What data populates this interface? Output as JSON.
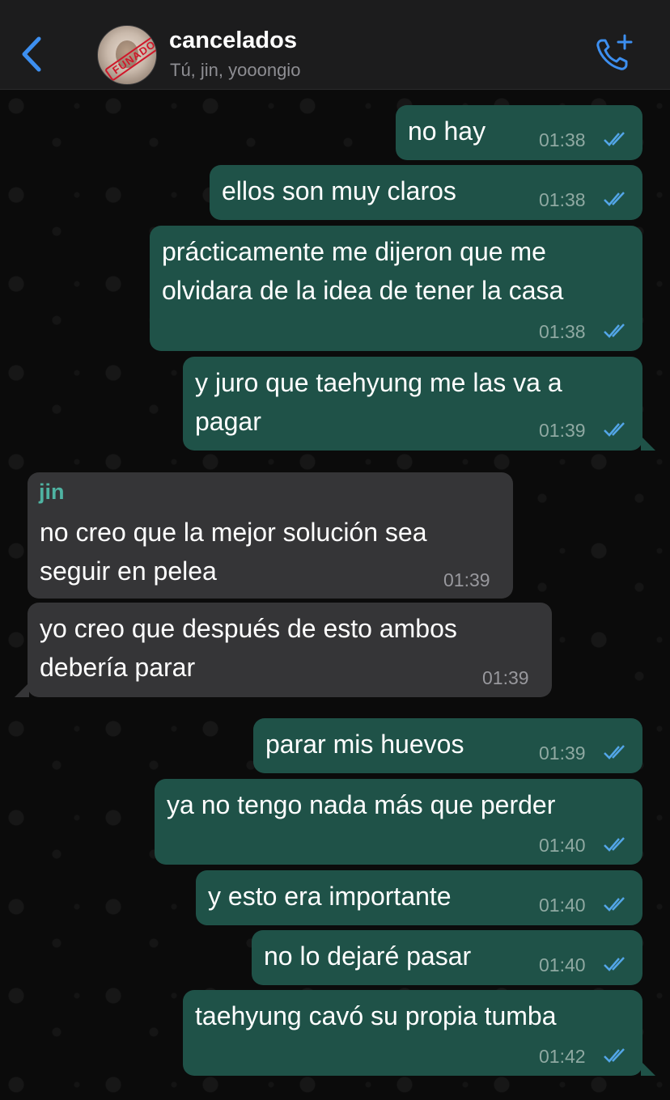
{
  "header": {
    "back_icon": "chevron-left-icon",
    "group_name": "cancelados",
    "members": "Tú, jin, yooongio",
    "avatar_stamp": "FUNADO",
    "call_icon": "phone-plus-icon",
    "accent_color": "#3d8ff0"
  },
  "messages": [
    {
      "text": "no hay",
      "time": "01:38",
      "direction": "outgoing",
      "read": true
    },
    {
      "text": "ellos son muy claros",
      "time": "01:38",
      "direction": "outgoing",
      "read": true
    },
    {
      "text_line1": "prácticamente me dijeron que me",
      "text_line2": "olvidara de la idea de tener la casa",
      "time": "01:38",
      "direction": "outgoing",
      "read": true
    },
    {
      "text_line1": "y juro que taehyung me las va a",
      "text_line2": "pagar",
      "time": "01:39",
      "direction": "outgoing",
      "read": true
    },
    {
      "sender": "jin",
      "text_line1": "no creo que la mejor solución sea",
      "text_line2": "seguir en pelea",
      "time": "01:39",
      "direction": "incoming"
    },
    {
      "text_line1": "yo creo que después de esto ambos",
      "text_line2": "debería parar",
      "time": "01:39",
      "direction": "incoming"
    },
    {
      "text": "parar mis huevos",
      "time": "01:39",
      "direction": "outgoing",
      "read": true
    },
    {
      "text": "ya no tengo nada más que perder",
      "time": "01:40",
      "direction": "outgoing",
      "read": true
    },
    {
      "text": "y esto era importante",
      "time": "01:40",
      "direction": "outgoing",
      "read": true
    },
    {
      "text": "no lo dejaré pasar",
      "time": "01:40",
      "direction": "outgoing",
      "read": true
    },
    {
      "text": "taehyung cavó su propia tumba",
      "time": "01:42",
      "direction": "outgoing",
      "read": true
    }
  ],
  "colors": {
    "outgoing_bubble": "#1f5248",
    "incoming_bubble": "#353537",
    "read_ticks": "#53a6e8",
    "sender_name": "#4fb3a2"
  }
}
